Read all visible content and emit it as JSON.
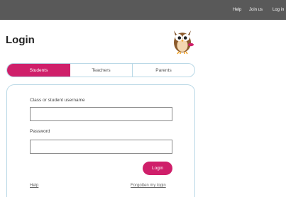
{
  "topnav": {
    "help": "Help",
    "join": "Join us",
    "login": "Log in"
  },
  "page": {
    "title": "Login"
  },
  "mascot_icon": "owl-icon",
  "tabs": [
    {
      "label": "Students",
      "active": true
    },
    {
      "label": "Teachers",
      "active": false
    },
    {
      "label": "Parents",
      "active": false
    }
  ],
  "form": {
    "username_label": "Class or student username",
    "username_value": "",
    "password_label": "Password",
    "password_value": "",
    "submit_label": "Login",
    "help_link": "Help",
    "forgot_link": "Forgotten my login"
  },
  "colors": {
    "accent": "#cf1f6a",
    "topbar": "#595959",
    "border": "#b9d8e6"
  }
}
